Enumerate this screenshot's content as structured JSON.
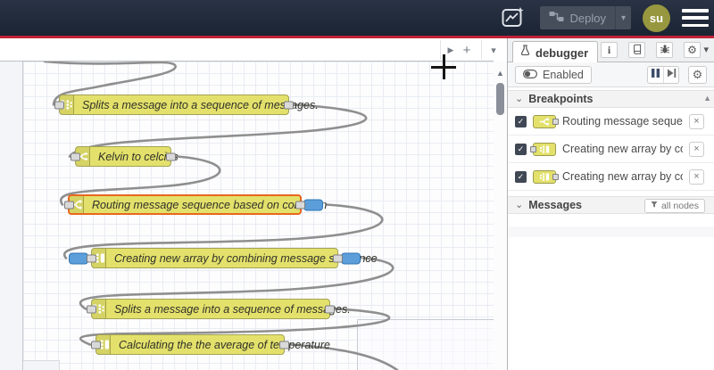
{
  "header": {
    "deploy_label": "Deploy",
    "user_initials": "su"
  },
  "glyphs": {
    "caret_down": "▾",
    "chevron_down": "⌄",
    "play": "▶",
    "plus": "+",
    "scroll_up": "▲",
    "close": "×",
    "check": "✓",
    "info": "i",
    "gear": "⚙"
  },
  "canvas": {
    "nodes": [
      {
        "type": "split",
        "label": "Splits a message into a sequence of messages."
      },
      {
        "type": "change",
        "label": "Kelvin to celcius"
      },
      {
        "type": "switch",
        "label": "Routing message sequence based on condition",
        "selected": true,
        "breakpoint_output": true
      },
      {
        "type": "join",
        "label": "Creating new array by combining message sequence",
        "breakpoint_input": true,
        "breakpoint_output": true
      },
      {
        "type": "split",
        "label": "Splits a message into a sequence of messages."
      },
      {
        "type": "join",
        "label": "Calculating the the average of temperature"
      }
    ]
  },
  "sidebar": {
    "tab_label": "debugger",
    "enabled_label": "Enabled",
    "breakpoints": {
      "title": "Breakpoints",
      "items": [
        {
          "label": "Routing message sequence based on condition",
          "node_type": "switch",
          "port": "output",
          "checked": true
        },
        {
          "label": "Creating new array by combining message sequence",
          "node_type": "join",
          "port": "input",
          "checked": true
        },
        {
          "label": "Creating new array by combining message sequence",
          "node_type": "join",
          "port": "output",
          "checked": true
        }
      ]
    },
    "messages": {
      "title": "Messages",
      "filter_label": "all nodes"
    }
  },
  "colors": {
    "header_bg": "#1b2433",
    "accent_red": "#bf2339",
    "node_fill": "#e3e16b",
    "node_border": "#a3a256",
    "selected_border": "#e8671e",
    "breakpoint_blue": "#5b9ed9",
    "wire": "#8f8f8f",
    "avatar_bg": "#97973f"
  }
}
